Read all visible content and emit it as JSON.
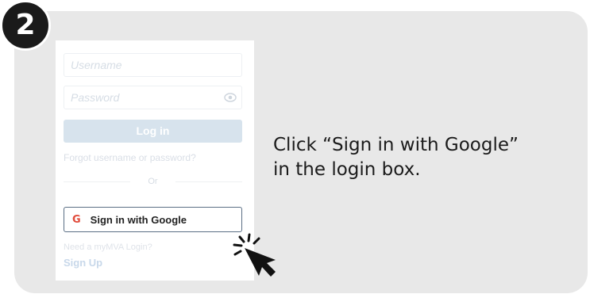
{
  "step": {
    "number": "2"
  },
  "login": {
    "username_placeholder": "Username",
    "password_placeholder": "Password",
    "login_label": "Log in",
    "forgot_label": "Forgot username or password?",
    "or_label": "Or",
    "google_label": "Sign in with Google",
    "need_label": "Need a myMVA Login?",
    "signup_label": "Sign Up"
  },
  "instruction": {
    "line1": "Click “Sign in with Google”",
    "line2": "in the login box."
  },
  "colors": {
    "card_bg": "#e8e8e8",
    "badge_bg": "#1a1a1a",
    "login_button": "#d7e3ed",
    "google_border": "#5a6e84"
  },
  "icons": [
    "eye-icon",
    "google-g-icon",
    "mouse-cursor-icon"
  ]
}
